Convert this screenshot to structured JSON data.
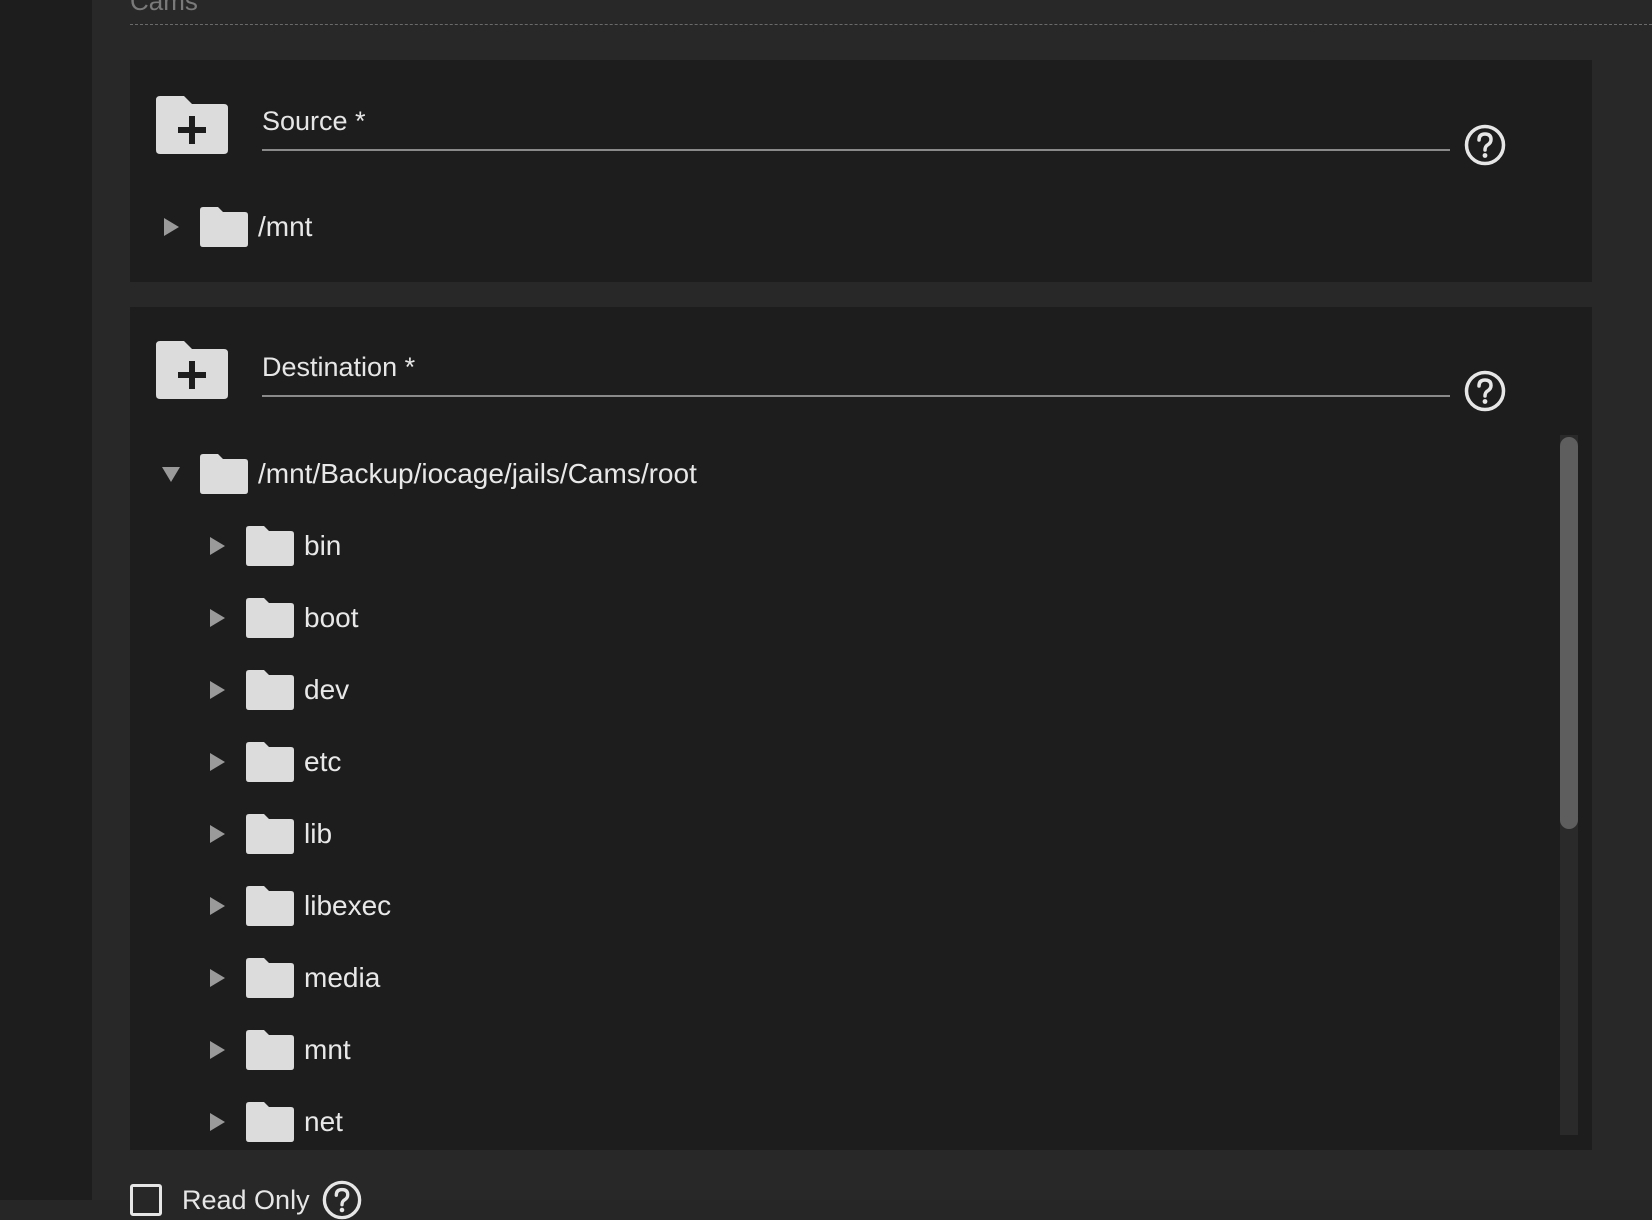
{
  "top_field": {
    "partial_label": "Cams"
  },
  "source": {
    "label": "Source *",
    "value": "",
    "tree": [
      {
        "label": "/mnt",
        "expanded": false
      }
    ]
  },
  "destination": {
    "label": "Destination *",
    "value": "",
    "root": {
      "label": "/mnt/Backup/iocage/jails/Cams/root",
      "expanded": true
    },
    "children": [
      {
        "label": "bin"
      },
      {
        "label": "boot"
      },
      {
        "label": "dev"
      },
      {
        "label": "etc"
      },
      {
        "label": "lib"
      },
      {
        "label": "libexec"
      },
      {
        "label": "media"
      },
      {
        "label": "mnt"
      },
      {
        "label": "net"
      }
    ]
  },
  "read_only": {
    "label": "Read Only",
    "checked": false
  },
  "icons": {
    "add_folder": "folder-plus-icon",
    "help": "help-circle-icon",
    "folder": "folder-icon",
    "collapsed": "triangle-right-icon",
    "expanded": "triangle-down-icon"
  },
  "colors": {
    "page_background": "#262626",
    "panel_background": "#1d1d1d",
    "text": "#e8e8e8",
    "icon": "#dcdcdc"
  }
}
